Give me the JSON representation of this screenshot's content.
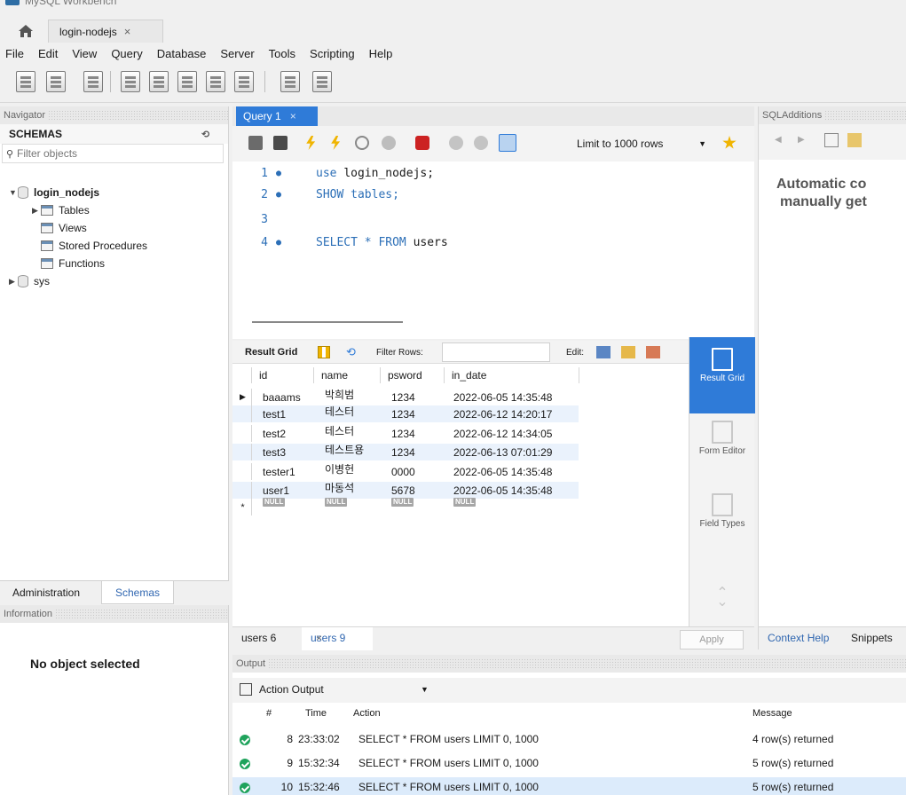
{
  "window": {
    "title": "MySQL Workbench"
  },
  "connection_tab": {
    "label": "login-nodejs",
    "close": "×"
  },
  "menu": [
    "File",
    "Edit",
    "View",
    "Query",
    "Database",
    "Server",
    "Tools",
    "Scripting",
    "Help"
  ],
  "navigator": {
    "header": "Navigator",
    "schemas_label": "SCHEMAS",
    "filter_placeholder": "Filter objects",
    "tree": [
      {
        "label": "login_nodejs",
        "bold": true
      },
      {
        "label": "Tables"
      },
      {
        "label": "Views"
      },
      {
        "label": "Stored Procedures"
      },
      {
        "label": "Functions"
      },
      {
        "label": "sys"
      }
    ],
    "tabs": {
      "admin": "Administration",
      "schemas": "Schemas"
    }
  },
  "information": {
    "header": "Information",
    "empty": "No object selected"
  },
  "editor": {
    "tab_label": "Query 1",
    "tab_close": "×",
    "limit": "Limit to 1000 rows",
    "lines": [
      {
        "n": "1",
        "dot": "●",
        "kw": "use ",
        "rest": "login_nodejs;"
      },
      {
        "n": "2",
        "dot": "●",
        "kw": "SHOW tables;",
        "rest": ""
      },
      {
        "n": "3",
        "dot": "",
        "kw": "",
        "rest": ""
      },
      {
        "n": "4",
        "dot": "●",
        "kw": "SELECT * FROM ",
        "rest": "users"
      }
    ]
  },
  "result": {
    "toolbar": {
      "grid": "Result Grid",
      "filter": "Filter Rows:",
      "edit": "Edit:"
    },
    "columns": [
      "id",
      "name",
      "psword",
      "in_date"
    ],
    "rows": [
      [
        "baaams",
        "박희범",
        "1234",
        "2022-06-05 14:35:48"
      ],
      [
        "test1",
        "테스터",
        "1234",
        "2022-06-12 14:20:17"
      ],
      [
        "test2",
        "테스터",
        "1234",
        "2022-06-12 14:34:05"
      ],
      [
        "test3",
        "테스트용",
        "1234",
        "2022-06-13 07:01:29"
      ],
      [
        "tester1",
        "이병헌",
        "0000",
        "2022-06-05 14:35:48"
      ],
      [
        "user1",
        "마동석",
        "5678",
        "2022-06-05 14:35:48"
      ]
    ],
    "null_label": "NULL",
    "side": {
      "result_grid": "Result Grid",
      "form_editor": "Form Editor",
      "field_types": "Field Types"
    },
    "tabs": {
      "users6": "users 6",
      "users9": "users 9",
      "close": "×",
      "apply": "Apply"
    }
  },
  "output": {
    "header": "Output",
    "selector": "Action Output",
    "columns": {
      "num": "#",
      "time": "Time",
      "action": "Action",
      "message": "Message"
    },
    "rows": [
      {
        "num": "8",
        "time": "23:33:02",
        "action": "SELECT * FROM users LIMIT 0, 1000",
        "message": "4 row(s) returned"
      },
      {
        "num": "9",
        "time": "15:32:34",
        "action": "SELECT * FROM users LIMIT 0, 1000",
        "message": "5 row(s) returned"
      },
      {
        "num": "10",
        "time": "15:32:46",
        "action": "SELECT * FROM users LIMIT 0, 1000",
        "message": "5 row(s) returned"
      }
    ]
  },
  "sql_additions": {
    "header": "SQLAdditions",
    "text_line1": "Automatic co",
    "text_line2": "manually get",
    "tabs": {
      "context": "Context Help",
      "snippets": "Snippets"
    }
  },
  "colors": {
    "accent": "#2f7bd8",
    "ok": "#1fa35c",
    "keyword": "#2c6fb7"
  }
}
